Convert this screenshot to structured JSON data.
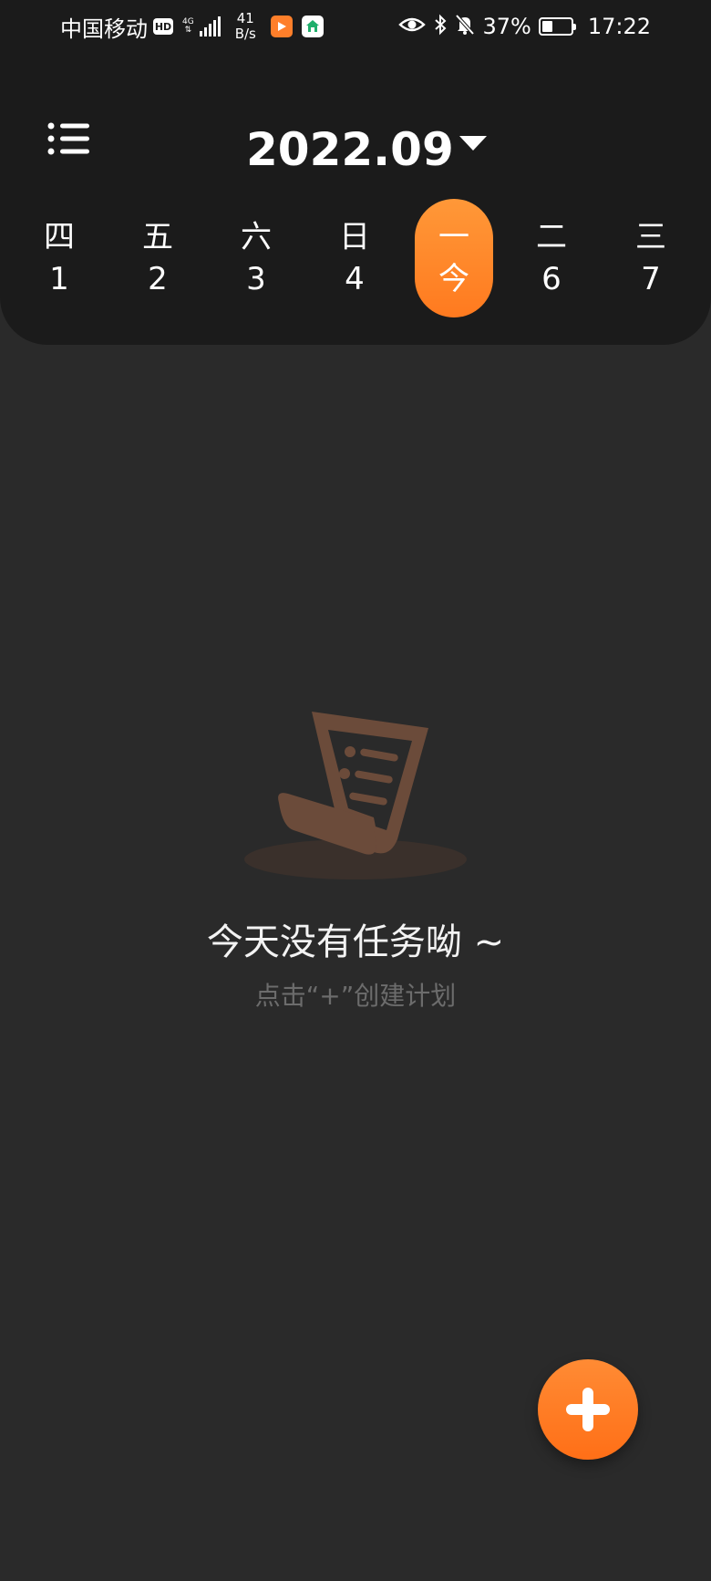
{
  "status_bar": {
    "carrier": "中国移动",
    "hd_badge": "HD",
    "network_type": "4G",
    "net_speed_value": "41",
    "net_speed_unit": "B/s",
    "battery_percent": "37%",
    "battery_level": 0.37,
    "time": "17:22"
  },
  "header": {
    "month": "2022.09"
  },
  "week": {
    "days": [
      {
        "weekday": "四",
        "date": "1"
      },
      {
        "weekday": "五",
        "date": "2"
      },
      {
        "weekday": "六",
        "date": "3"
      },
      {
        "weekday": "日",
        "date": "4"
      },
      {
        "weekday": "一",
        "date": "今"
      },
      {
        "weekday": "二",
        "date": "6"
      },
      {
        "weekday": "三",
        "date": "7"
      }
    ],
    "selected_index": 4
  },
  "empty_state": {
    "title": "今天没有任务呦 ~",
    "hint": "点击“+”创建计划"
  },
  "colors": {
    "accent": "#ff7a1f",
    "header_bg": "#1b1b1b",
    "page_bg": "#2a2a2a",
    "hint_text": "#6c6c6c"
  },
  "icons": {
    "menu": "list-menu-icon",
    "month_dropdown": "caret-down-icon",
    "empty": "document-list-icon",
    "fab": "plus-icon"
  }
}
